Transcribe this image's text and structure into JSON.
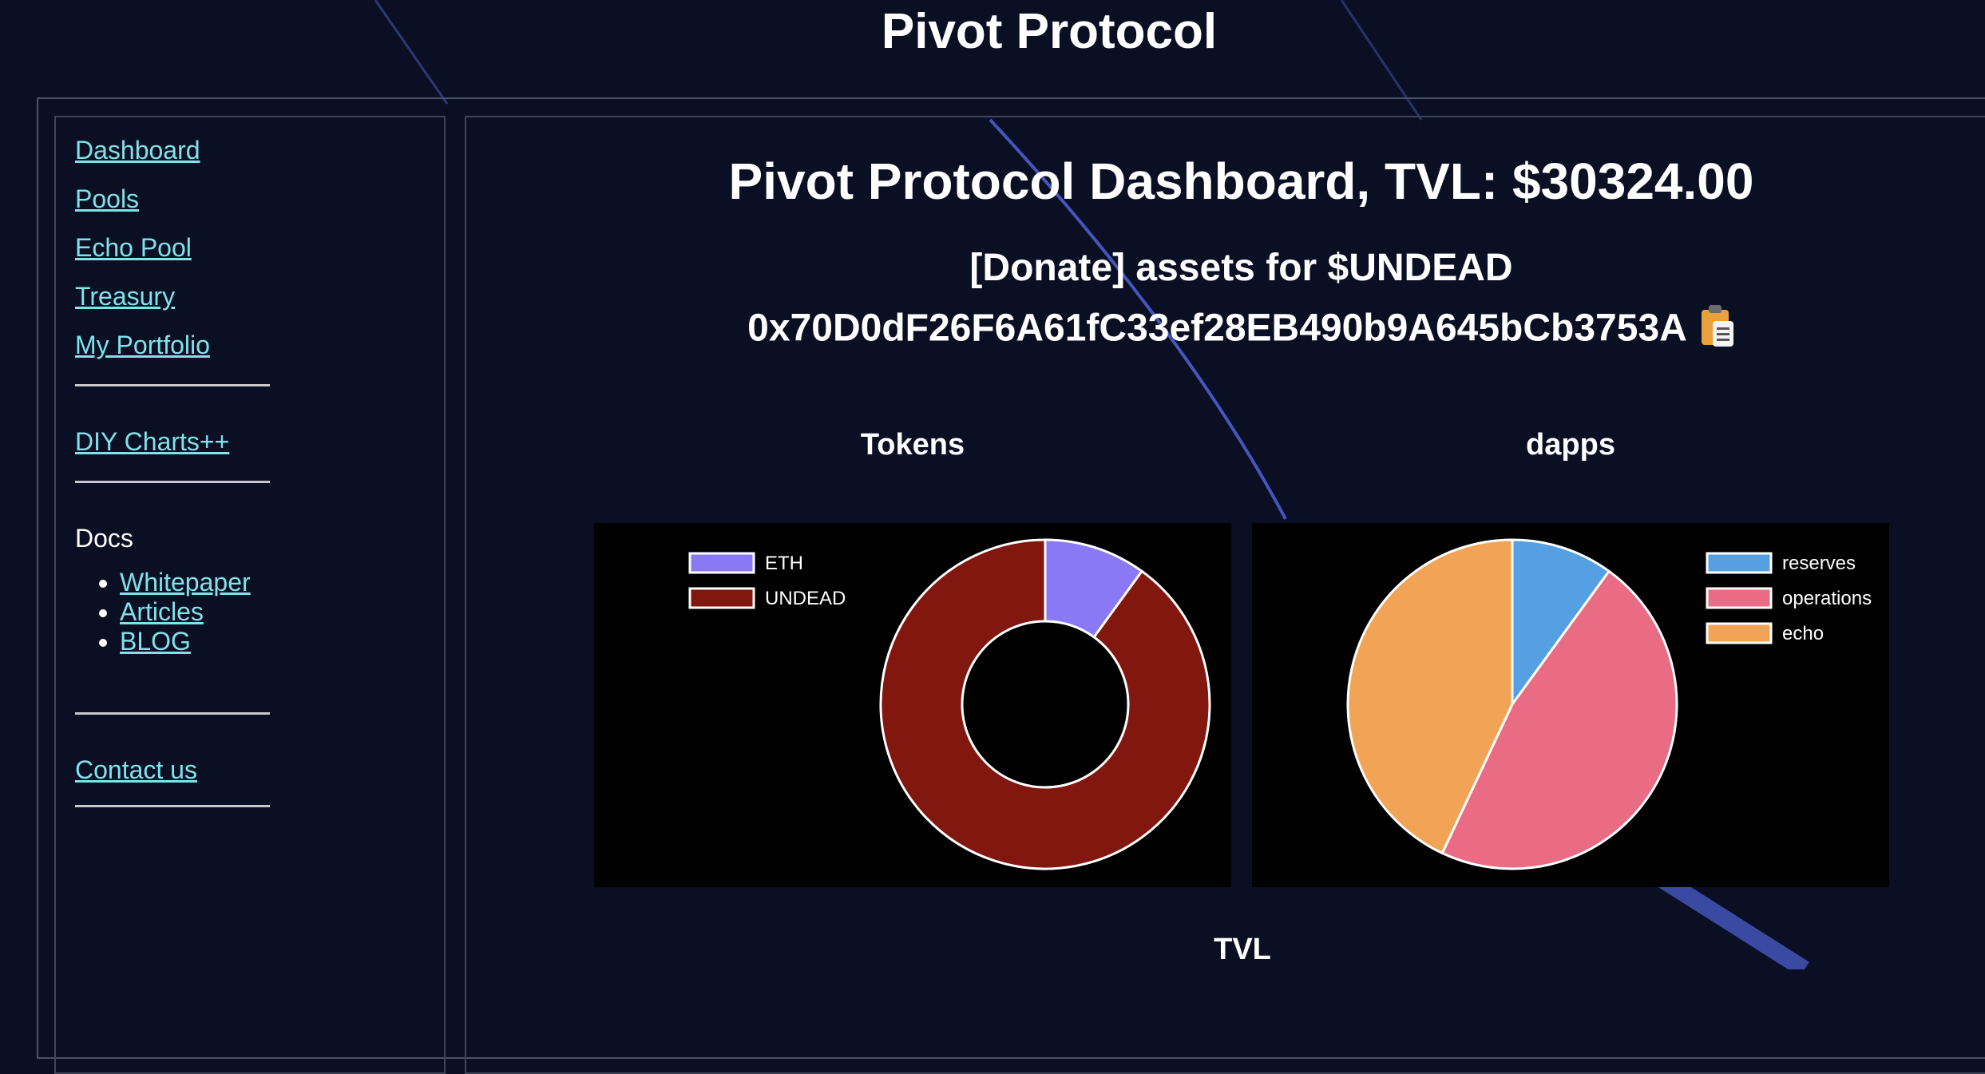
{
  "header": {
    "title": "Pivot Protocol"
  },
  "sidebar": {
    "nav": [
      {
        "label": "Dashboard"
      },
      {
        "label": "Pools"
      },
      {
        "label": "Echo Pool"
      },
      {
        "label": "Treasury"
      },
      {
        "label": "My Portfolio"
      }
    ],
    "diy_label": "DIY Charts++",
    "docs_label": "Docs",
    "docs_links": [
      {
        "label": "Whitepaper"
      },
      {
        "label": "Articles"
      },
      {
        "label": "BLOG"
      }
    ],
    "contact_label": "Contact us"
  },
  "main": {
    "title": "Pivot Protocol Dashboard, TVL: $30324.00",
    "donate_text": "[Donate] assets for $UNDEAD",
    "address": "0x70D0dF26F6A61fC33ef28EB490b9A645bCb3753A",
    "copy_icon": "clipboard-icon",
    "tvl_heading": "TVL"
  },
  "chart_data": [
    {
      "type": "pie",
      "variant": "doughnut",
      "title": "Tokens",
      "legend_position": "top-left",
      "labels": [
        "ETH",
        "UNDEAD"
      ],
      "values": [
        10,
        90
      ],
      "colors": [
        "#8b78f5",
        "#82170f"
      ]
    },
    {
      "type": "pie",
      "title": "dapps",
      "legend_position": "top-right",
      "labels": [
        "reserves",
        "operations",
        "echo"
      ],
      "values": [
        10,
        47,
        43
      ],
      "colors": [
        "#55a0e2",
        "#ea6c84",
        "#f2a456"
      ]
    }
  ],
  "colors": {
    "background": "#0b0f24",
    "link": "#7fe3e8",
    "chart_background": "#000000"
  }
}
